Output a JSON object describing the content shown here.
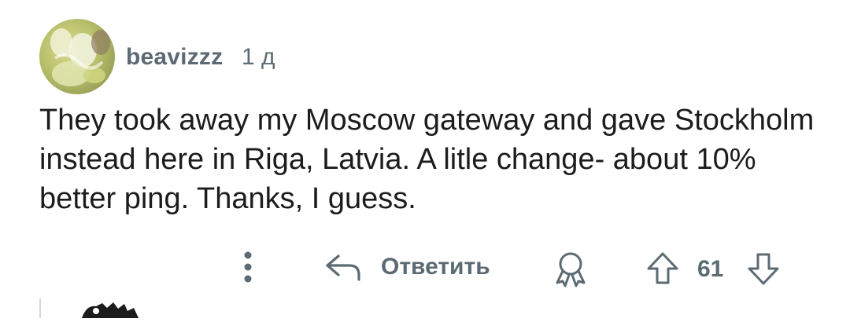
{
  "comment": {
    "username": "beavizzz",
    "timestamp": "1 д",
    "body": "They took away my Moscow gateway and gave Stockholm instead here in Riga, Latvia. A litle change- about 10% better ping. Thanks, I guess.",
    "vote_count": "61"
  },
  "actions": {
    "reply_label": "Ответить"
  },
  "icons": {
    "more": "more-vertical-icon",
    "reply": "reply-arrow-icon",
    "award": "award-icon",
    "upvote": "upvote-arrow-icon",
    "downvote": "downvote-arrow-icon"
  },
  "colors": {
    "meta_text": "#5c6b73",
    "body_text": "#1c1c1c",
    "icon_stroke": "#5c6b73"
  }
}
